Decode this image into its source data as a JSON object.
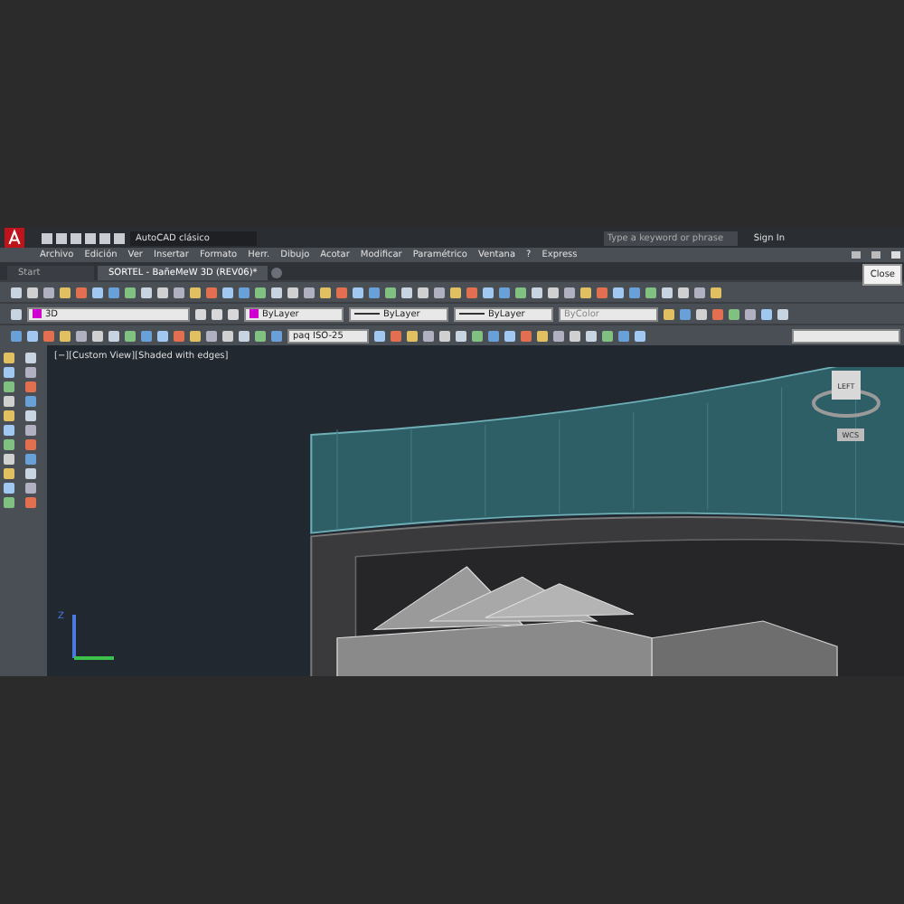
{
  "title_bar": {
    "workspace": "AutoCAD clásico",
    "search": {
      "placeholder": "Type a keyword or phrase"
    },
    "sign_in": "Sign In"
  },
  "menu": [
    "Archivo",
    "Edición",
    "Ver",
    "Insertar",
    "Formato",
    "Herr.",
    "Dibujo",
    "Acotar",
    "Modificar",
    "Paramétrico",
    "Ventana",
    "?",
    "Express"
  ],
  "tabs": [
    {
      "label": "Start",
      "selected": false
    },
    {
      "label": "SORTEL - BañeMeW 3D (REV06)*",
      "selected": true
    }
  ],
  "close_tooltip": "Close",
  "properties": {
    "layer": "3D",
    "color_setting": "ByLayer",
    "linetype": "ByLayer",
    "lineweight": "ByLayer",
    "plot_style": "ByColor",
    "dim_style": "paq ISO-25"
  },
  "viewport": {
    "label": "[−][Custom View][Shaded with edges]",
    "viewcube_face": "LEFT",
    "ucs": "WCS",
    "axis_label": "Z"
  }
}
